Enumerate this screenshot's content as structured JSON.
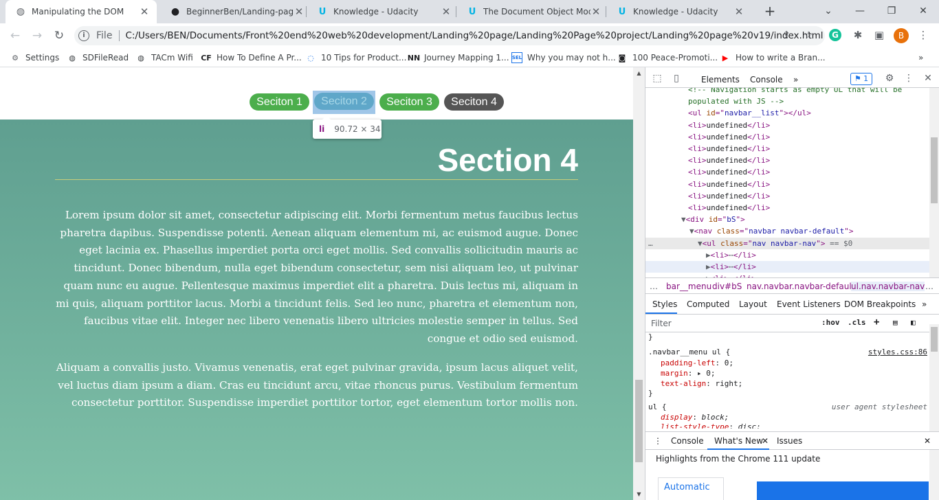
{
  "browser": {
    "tabs": [
      {
        "title": "Manipulating the DOM",
        "icon": "globe-icon",
        "active": true
      },
      {
        "title": "BeginnerBen/Landing-page-",
        "icon": "github-icon",
        "active": false
      },
      {
        "title": "Knowledge - Udacity",
        "icon": "udacity-icon",
        "active": false
      },
      {
        "title": "The Document Object Model",
        "icon": "udacity-icon",
        "active": false
      },
      {
        "title": "Knowledge - Udacity",
        "icon": "udacity-icon",
        "active": false
      }
    ],
    "close_glyph": "✕",
    "new_tab_glyph": "+",
    "window_controls": {
      "dropdown": "⌄",
      "minimize": "—",
      "restore": "❐",
      "close": "✕"
    },
    "nav": {
      "back": "←",
      "forward": "→",
      "reload": "↻"
    },
    "address": {
      "info_glyph": "i",
      "scheme": "File",
      "url": "C:/Users/BEN/Documents/Front%20end%20web%20development/Landing%20page/Landing%20Page%20project/Landing%20page%20v19/index.html"
    },
    "toolbar_icons": {
      "share": "⇪",
      "star": "☆",
      "grammarly": "G",
      "extensions": "✱",
      "sidepanel": "▣",
      "profile": "B",
      "menu": "⋮"
    },
    "bookmarks": [
      {
        "label": "Settings",
        "icon": "gear-icon",
        "glyph": "⚙"
      },
      {
        "label": "SDFileRead",
        "icon": "globe-icon",
        "glyph": "◍"
      },
      {
        "label": "TACm Wifi",
        "icon": "globe-icon",
        "glyph": "◍"
      },
      {
        "label": "How To Define A Pr...",
        "icon": "cf-icon",
        "glyph": "CF"
      },
      {
        "label": "10 Tips for Product...",
        "icon": "swirl-icon",
        "glyph": "◌"
      },
      {
        "label": "Journey Mapping 1...",
        "icon": "nn-icon",
        "glyph": "NN"
      },
      {
        "label": "Why you may not h...",
        "icon": "sel-icon",
        "glyph": "SEL"
      },
      {
        "label": "100 Peace-Promoti...",
        "icon": "dark-logo-icon",
        "glyph": "◙"
      },
      {
        "label": "How to write a Bran...",
        "icon": "youtube-icon",
        "glyph": "▶"
      }
    ],
    "bookmarks_overflow": "»"
  },
  "page": {
    "nav_items": [
      {
        "label": "Seciton 1",
        "color": "#4cae4c"
      },
      {
        "label": "Seciton 2",
        "color": "#4cae4c"
      },
      {
        "label": "Seciton 3",
        "color": "#4cae4c"
      },
      {
        "label": "Seciton 4",
        "color": "#555555"
      }
    ],
    "tooltip": {
      "tag": "li",
      "size": "90.72 × 34"
    },
    "section_title": "Section 4",
    "paragraphs": [
      "Lorem ipsum dolor sit amet, consectetur adipiscing elit. Morbi fermentum metus faucibus lectus pharetra dapibus. Suspendisse potenti. Aenean aliquam elementum mi, ac euismod augue. Donec eget lacinia ex. Phasellus imperdiet porta orci eget mollis. Sed convallis sollicitudin mauris ac tincidunt. Donec bibendum, nulla eget bibendum consectetur, sem nisi aliquam leo, ut pulvinar quam nunc eu augue. Pellentesque maximus imperdiet elit a pharetra. Duis lectus mi, aliquam in mi quis, aliquam porttitor lacus. Morbi a tincidunt felis. Sed leo nunc, pharetra et elementum non, faucibus vitae elit. Integer nec libero venenatis libero ultricies molestie semper in tellus. Sed congue et odio sed euismod.",
      "Aliquam a convallis justo. Vivamus venenatis, erat eget pulvinar gravida, ipsum lacus aliquet velit, vel luctus diam ipsum a diam. Cras eu tincidunt arcu, vitae rhoncus purus. Vestibulum fermentum consectetur porttitor. Suspendisse imperdiet porttitor tortor, eget elementum tortor mollis non."
    ]
  },
  "devtools": {
    "tabs": {
      "elements": "Elements",
      "console": "Console",
      "more": "»"
    },
    "issues_badge": "1",
    "dom_lines": [
      {
        "segments": [
          [
            "c",
            "<!-- Navigation starts as empty UL that will be"
          ]
        ]
      },
      {
        "segments": [
          [
            "c",
            "populated with JS -->"
          ]
        ]
      },
      {
        "segments": [
          [
            "t",
            "<ul "
          ],
          [
            "a",
            "id"
          ],
          [
            "t",
            "=\""
          ],
          [
            "v",
            "navbar__list"
          ],
          [
            "t",
            "\"></ul>"
          ]
        ]
      },
      {
        "segments": [
          [
            "t",
            "<li>"
          ],
          [
            "tx",
            "undefined"
          ],
          [
            "t",
            "</li>"
          ]
        ]
      },
      {
        "segments": [
          [
            "t",
            "<li>"
          ],
          [
            "tx",
            "undefined"
          ],
          [
            "t",
            "</li>"
          ]
        ]
      },
      {
        "segments": [
          [
            "t",
            "<li>"
          ],
          [
            "tx",
            "undefined"
          ],
          [
            "t",
            "</li>"
          ]
        ]
      },
      {
        "segments": [
          [
            "t",
            "<li>"
          ],
          [
            "tx",
            "undefined"
          ],
          [
            "t",
            "</li>"
          ]
        ]
      },
      {
        "segments": [
          [
            "t",
            "<li>"
          ],
          [
            "tx",
            "undefined"
          ],
          [
            "t",
            "</li>"
          ]
        ]
      },
      {
        "segments": [
          [
            "t",
            "<li>"
          ],
          [
            "tx",
            "undefined"
          ],
          [
            "t",
            "</li>"
          ]
        ]
      },
      {
        "segments": [
          [
            "t",
            "<li>"
          ],
          [
            "tx",
            "undefined"
          ],
          [
            "t",
            "</li>"
          ]
        ]
      },
      {
        "segments": [
          [
            "t",
            "<li>"
          ],
          [
            "tx",
            "undefined"
          ],
          [
            "t",
            "</li>"
          ]
        ]
      },
      {
        "segments": [
          [
            "mut",
            "▼"
          ],
          [
            "t",
            "<div "
          ],
          [
            "a",
            "id"
          ],
          [
            "t",
            "=\""
          ],
          [
            "v",
            "bS"
          ],
          [
            "t",
            "\">"
          ]
        ]
      },
      {
        "segments": [
          [
            "mut",
            "▼"
          ],
          [
            "t",
            "<nav "
          ],
          [
            "a",
            "class"
          ],
          [
            "t",
            "=\""
          ],
          [
            "v",
            "navbar navbar-default"
          ],
          [
            "t",
            "\">"
          ]
        ]
      },
      {
        "segments": [
          [
            "mut",
            "▼"
          ],
          [
            "t",
            "<ul "
          ],
          [
            "a",
            "class"
          ],
          [
            "t",
            "=\""
          ],
          [
            "v",
            "nav navbar-nav"
          ],
          [
            "t",
            "\">"
          ],
          [
            "mut",
            " == $0"
          ]
        ]
      },
      {
        "segments": [
          [
            "mut",
            "▶"
          ],
          [
            "t",
            "<li>"
          ],
          [
            "mut",
            "⋯"
          ],
          [
            "t",
            "</li>"
          ]
        ]
      },
      {
        "segments": [
          [
            "mut",
            "▶"
          ],
          [
            "t",
            "<li>"
          ],
          [
            "mut",
            "⋯"
          ],
          [
            "t",
            "</li>"
          ]
        ]
      },
      {
        "segments": [
          [
            "mut",
            "▶"
          ],
          [
            "t",
            "<li>"
          ],
          [
            "mut",
            "⋯"
          ],
          [
            "t",
            "</li>"
          ]
        ]
      }
    ],
    "row_dots": "…",
    "breadcrumbs": [
      "…",
      "bar__menu",
      "div#bS",
      "nav.navbar.navbar-default",
      "ul.nav.navbar-nav",
      "…"
    ],
    "subtabs": [
      "Styles",
      "Computed",
      "Layout",
      "Event Listeners",
      "DOM Breakpoints",
      "»"
    ],
    "filter_placeholder": "Filter",
    "filter_buttons": [
      ":hov",
      ".cls",
      "+"
    ],
    "styles_lines": [
      {
        "text": "}"
      },
      {
        "text": ".navbar__menu ul {",
        "link": "styles.css:86"
      },
      {
        "prop": "padding-left",
        "value": "0;"
      },
      {
        "prop": "margin",
        "value": "▸ 0;"
      },
      {
        "prop": "text-align",
        "value": "right;"
      },
      {
        "text": "}"
      },
      {
        "text": "ul {",
        "ua": "user agent stylesheet"
      },
      {
        "prop": "display",
        "value": "block;",
        "italic": true
      },
      {
        "prop": "list-style-type",
        "value": "disc;",
        "italic": true
      }
    ],
    "drawer_tabs": {
      "console": "Console",
      "whats_new": "What's New",
      "issues": "Issues"
    },
    "whats_new_highlight": "Highlights from the Chrome 111 update",
    "whats_new_card": "Automatic"
  }
}
